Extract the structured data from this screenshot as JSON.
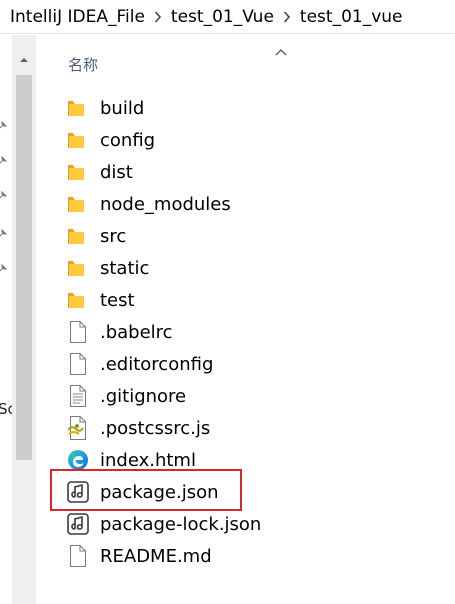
{
  "breadcrumb": {
    "items": [
      "IntelliJ IDEA_File",
      "test_01_Vue",
      "test_01_vue"
    ]
  },
  "nav_pane": {
    "clipped_text": "Sc"
  },
  "list_header": {
    "name_label": "名称"
  },
  "files": [
    {
      "name": "build",
      "icon": "folder-icon"
    },
    {
      "name": "config",
      "icon": "folder-icon"
    },
    {
      "name": "dist",
      "icon": "folder-icon"
    },
    {
      "name": "node_modules",
      "icon": "folder-icon"
    },
    {
      "name": "src",
      "icon": "folder-icon"
    },
    {
      "name": "static",
      "icon": "folder-icon"
    },
    {
      "name": "test",
      "icon": "folder-icon"
    },
    {
      "name": ".babelrc",
      "icon": "file-icon"
    },
    {
      "name": ".editorconfig",
      "icon": "file-icon"
    },
    {
      "name": ".gitignore",
      "icon": "text-file-icon"
    },
    {
      "name": ".postcssrc.js",
      "icon": "js-file-icon"
    },
    {
      "name": "index.html",
      "icon": "edge-html-icon"
    },
    {
      "name": "package.json",
      "icon": "json-file-icon",
      "highlighted": true
    },
    {
      "name": "package-lock.json",
      "icon": "json-file-icon"
    },
    {
      "name": "README.md",
      "icon": "file-icon"
    }
  ],
  "colors": {
    "folder": "#ffc83d",
    "folder_dark": "#e0a526",
    "highlight_border": "#d9262c",
    "header_text": "#4c607a"
  }
}
